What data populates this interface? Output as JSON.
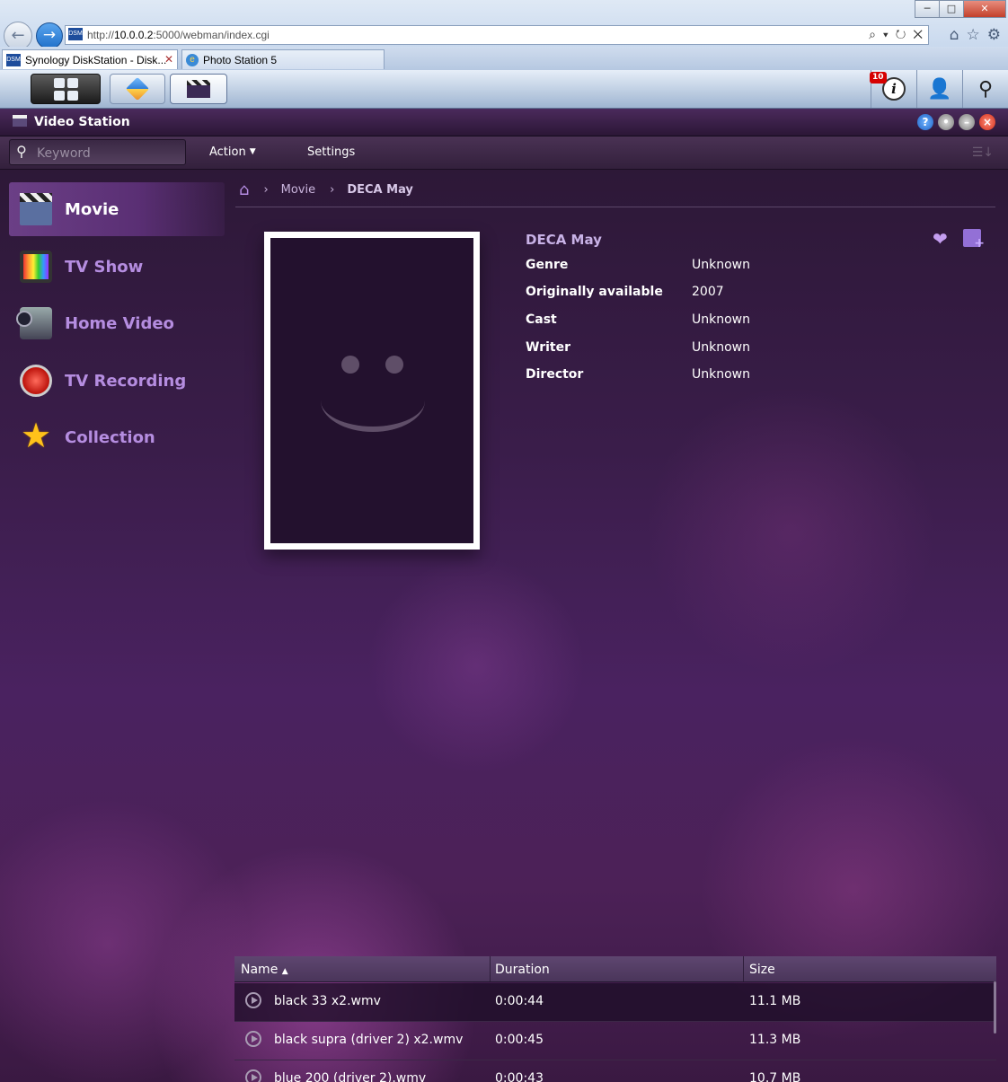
{
  "browser": {
    "url_prefix": "http://",
    "url_host": "10.0.0.2",
    "url_path": ":5000/webman/index.cgi",
    "tabs": [
      {
        "label": "Synology DiskStation - Disk...",
        "favicon": "DSM"
      },
      {
        "label": "Photo Station 5"
      }
    ]
  },
  "taskbar": {
    "notification_count": "10",
    "icons": [
      "main-menu-icon",
      "photo-station-icon",
      "video-station-icon",
      "info-icon",
      "user-icon",
      "search-icon"
    ]
  },
  "app": {
    "title": "Video Station",
    "toolbar": {
      "search_placeholder": "Keyword",
      "action_label": "Action",
      "settings_label": "Settings"
    },
    "sidebar": {
      "items": [
        {
          "label": "Movie",
          "icon": "movie-icon",
          "active": true
        },
        {
          "label": "TV Show",
          "icon": "tv-show-icon"
        },
        {
          "label": "Home Video",
          "icon": "home-video-icon"
        },
        {
          "label": "TV Recording",
          "icon": "tv-recording-icon"
        },
        {
          "label": "Collection",
          "icon": "collection-star-icon"
        }
      ]
    },
    "breadcrumb": {
      "items": [
        "Movie",
        "DECA May"
      ]
    },
    "detail": {
      "title": "DECA May",
      "fields": [
        {
          "key": "Genre",
          "value": "Unknown"
        },
        {
          "key": "Originally available",
          "value": "2007"
        },
        {
          "key": "Cast",
          "value": "Unknown"
        },
        {
          "key": "Writer",
          "value": "Unknown"
        },
        {
          "key": "Director",
          "value": "Unknown"
        }
      ]
    },
    "files": {
      "columns": {
        "name": "Name",
        "sort_indicator": "▲",
        "duration": "Duration",
        "size": "Size"
      },
      "rows": [
        {
          "name": "black 33 x2.wmv",
          "duration": "0:00:44",
          "size": "11.1 MB",
          "selected": true
        },
        {
          "name": "black supra (driver 2) x2.wmv",
          "duration": "0:00:45",
          "size": "11.3 MB"
        },
        {
          "name": "blue 200 (driver 2).wmv",
          "duration": "0:00:43",
          "size": "10.7 MB"
        }
      ]
    }
  },
  "colors": {
    "accent_purple": "#b58de0",
    "background": "#3a1d4a"
  }
}
